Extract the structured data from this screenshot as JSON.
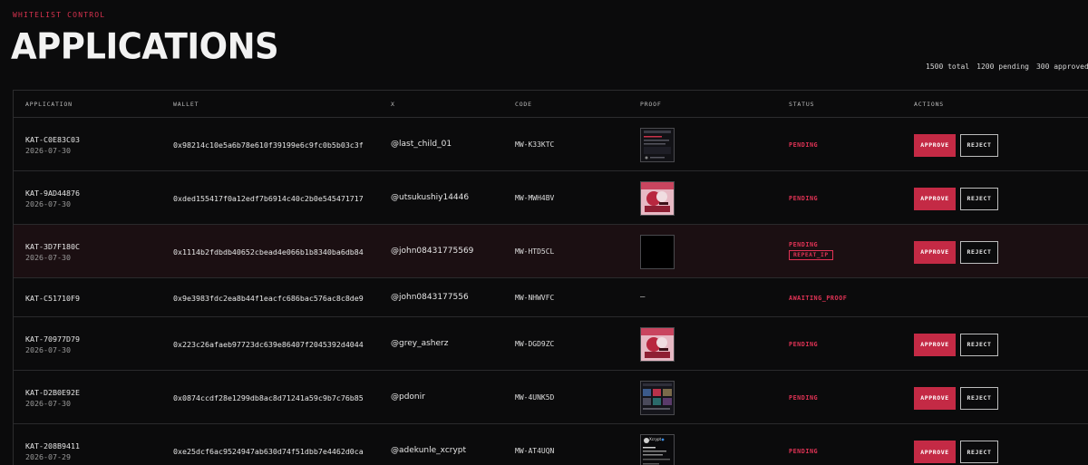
{
  "header": {
    "eyebrow": "WHITELIST CONTROL",
    "title": "APPLICATIONS",
    "stats": {
      "total": "1500 total",
      "pending": "1200 pending",
      "approved": "300 approved"
    }
  },
  "table": {
    "columns": [
      "APPLICATION",
      "WALLET",
      "X",
      "CODE",
      "PROOF",
      "STATUS",
      "ACTIONS"
    ],
    "actions": {
      "approve": "APPROVE",
      "reject": "REJECT"
    },
    "rows": [
      {
        "id": "KAT-C0E83C03",
        "date": "2026-07-30",
        "wallet": "0x98214c10e5a6b78e610f39199e6c9fc0b5b03c3f",
        "x": "@last_child_01",
        "code": "MW-K33KTC",
        "proof": "dark-feed",
        "status": "PENDING"
      },
      {
        "id": "KAT-9AD44876",
        "date": "2026-07-30",
        "wallet": "0xded155417f0a12edf7b6914c40c2b0e545471717",
        "x": "@utsukushiy14446",
        "code": "MW-MWH4BV",
        "proof": "pink-art",
        "status": "PENDING"
      },
      {
        "id": "KAT-3D7F180C",
        "date": "2026-07-30",
        "wallet": "0x1114b2fdbdb40652cbead4e066b1b8340ba6db84",
        "x": "@john08431775569",
        "code": "MW-HTD5CL",
        "proof": "black",
        "status": "PENDING",
        "tag": "REPEAT_IP"
      },
      {
        "id": "KAT-C51710F9",
        "date": "",
        "wallet": "0x9e3983fdc2ea8b44f1eacfc686bac576ac8c8de9",
        "x": "@john0843177556",
        "code": "MW-NHWVFC",
        "proof_placeholder": "—",
        "status": "AWAITING_PROOF"
      },
      {
        "id": "KAT-70977D79",
        "date": "2026-07-30",
        "wallet": "0x223c26afaeb97723dc639e86407f2045392d4044",
        "x": "@grey_asherz",
        "code": "MW-DGD9ZC",
        "proof": "pink-art",
        "status": "PENDING"
      },
      {
        "id": "KAT-D2B0E92E",
        "date": "2026-07-30",
        "wallet": "0x0874ccdf28e1299db8ac8d71241a59c9b7c76b85",
        "x": "@pdonir",
        "code": "MW-4UNK5D",
        "proof": "grid-feed",
        "status": "PENDING"
      },
      {
        "id": "KAT-208B9411",
        "date": "2026-07-29",
        "wallet": "0xe25dcf6ac9524947ab630d74f51dbb7e4462d0ca",
        "x": "@adekunle_xcrypt",
        "code": "MW-AT4UQN",
        "proof": "tweet",
        "proof_text": "Xcrypt",
        "status": "PENDING"
      }
    ]
  },
  "colors": {
    "accent": "#c42a45",
    "status": "#e03355",
    "background": "#0b0b0c",
    "flagged_row": "#1b0f12"
  }
}
